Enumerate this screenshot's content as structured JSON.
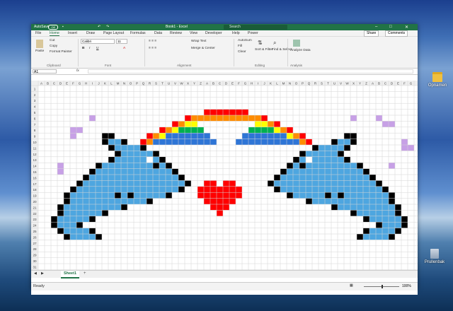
{
  "window": {
    "autosave_label": "AutoSave",
    "autosave_state": "Off",
    "title": "Book1 - Excel",
    "search_placeholder": "Search",
    "accent": "#217346"
  },
  "menu": {
    "items": [
      "File",
      "Home",
      "Insert",
      "Draw",
      "Page Layout",
      "Formulas",
      "Data",
      "Review",
      "View",
      "Developer",
      "Help",
      "Power"
    ],
    "share_label": "Share",
    "comments_label": "Comments"
  },
  "ribbon": {
    "paste": "Paste",
    "cut": "Cut",
    "copy": "Copy",
    "format_painter": "Format Painter",
    "clipboard_group": "Clipboard",
    "font_name": "Calibri",
    "font_size": "11",
    "font_group": "Font",
    "wrap_text": "Wrap Text",
    "merge_center": "Merge & Center",
    "alignment_group": "Alignment",
    "autosum": "AutoSum",
    "fill": "Fill",
    "clear": "Clear",
    "sort_filter": "Sort & Filter",
    "find_select": "Find & Select",
    "editing_group": "Editing",
    "analyze_data": "Analyze Data",
    "analysis_group": "Analysis"
  },
  "formula_bar": {
    "name_box": "A1",
    "fx": "fx"
  },
  "grid": {
    "columns": [
      "A",
      "B",
      "C",
      "D",
      "E",
      "F",
      "G",
      "H",
      "I",
      "J",
      "K",
      "L",
      "M",
      "N",
      "O",
      "P",
      "Q",
      "R",
      "S",
      "T",
      "U",
      "V",
      "W",
      "X",
      "Y",
      "Z",
      "A",
      "B",
      "C",
      "D",
      "E",
      "F",
      "G",
      "H",
      "I",
      "J",
      "K",
      "L",
      "M",
      "N",
      "O",
      "P",
      "Q",
      "R",
      "S",
      "T",
      "U",
      "V",
      "W",
      "X",
      "Y",
      "Z",
      "A",
      "B",
      "C",
      "D",
      "E",
      "F",
      "G"
    ],
    "rows": [
      "1",
      "2",
      "3",
      "4",
      "5",
      "6",
      "7",
      "8",
      "9",
      "10",
      "11",
      "12",
      "13",
      "14",
      "15",
      "16",
      "17",
      "18",
      "19",
      "20",
      "21",
      "22",
      "23",
      "24",
      "25",
      "26",
      "27",
      "28",
      "29",
      "30",
      "31"
    ],
    "colors": {
      "red": "#ff0000",
      "orange": "#ff8c00",
      "yellow": "#ffff00",
      "green": "#00b050",
      "blue": "#2e75d6",
      "dolphin": "#4ea6e0",
      "black": "#000000",
      "white": "#ffffff",
      "lilac": "#c7a0e6"
    }
  },
  "sheet_tab": "Sheet1",
  "add_sheet": "+",
  "status": {
    "ready": "Ready",
    "zoom": "100%"
  },
  "desktop": {
    "folder_label": "Opnamen",
    "bin_label": "Prullenbak"
  }
}
